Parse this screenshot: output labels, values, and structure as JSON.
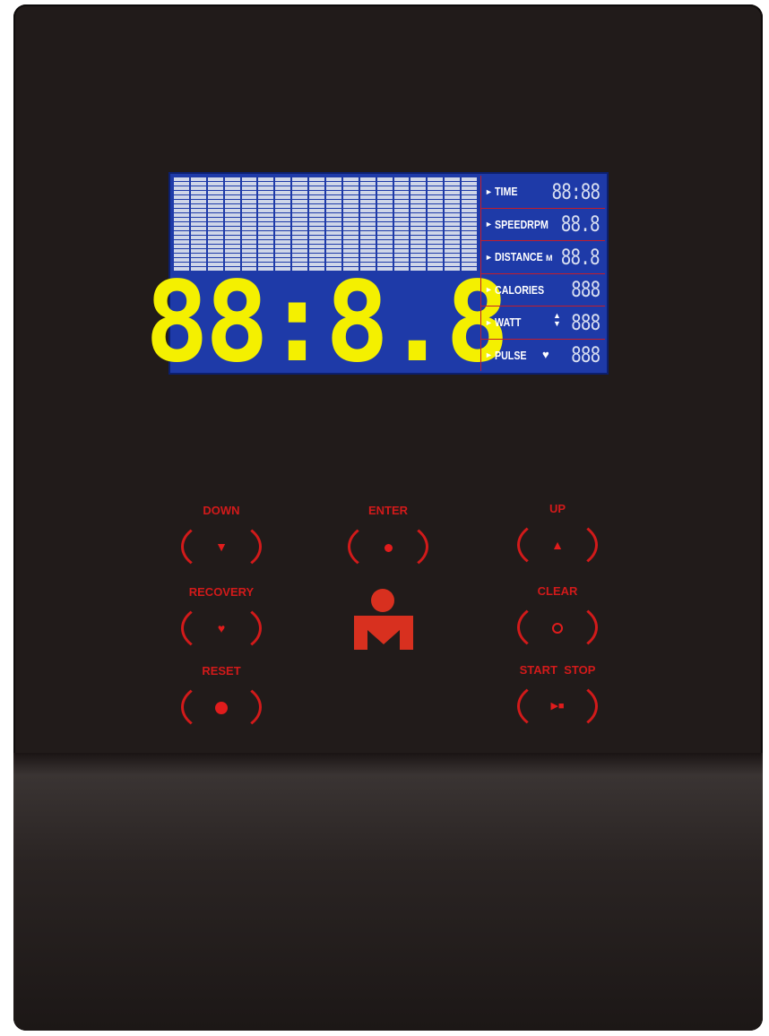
{
  "lcd": {
    "main_readout": "88:8.8",
    "metrics": [
      {
        "label": "TIME",
        "value": "88:88",
        "symbol": ""
      },
      {
        "label": "SPEEDRPM",
        "value": "88.8",
        "symbol": ""
      },
      {
        "label": "DISTANCE",
        "value": "88.8",
        "symbol": "M"
      },
      {
        "label": "CALORIES",
        "value": "888",
        "symbol": ""
      },
      {
        "label": "WATT",
        "value": "888",
        "symbol": "updown-arrows"
      },
      {
        "label": "PULSE",
        "value": "888",
        "symbol": "heart"
      }
    ]
  },
  "buttons": {
    "down": {
      "label": "DOWN",
      "icon": "triangle-down"
    },
    "enter": {
      "label": "ENTER",
      "icon": "dot"
    },
    "up": {
      "label": "UP",
      "icon": "triangle-up"
    },
    "recovery": {
      "label": "RECOVERY",
      "icon": "heart"
    },
    "clear": {
      "label": "CLEAR",
      "icon": "ring"
    },
    "reset": {
      "label": "RESET",
      "icon": "big-dot"
    },
    "start_stop": {
      "label": "START  STOP",
      "icon": "play-stop"
    }
  },
  "logo": {
    "icon": "m-dot-logo"
  },
  "colors": {
    "lcd_blue": "#1e3aa8",
    "segment_yellow": "#f4f000",
    "button_red": "#d21a1a",
    "panel": "#211b1a"
  }
}
